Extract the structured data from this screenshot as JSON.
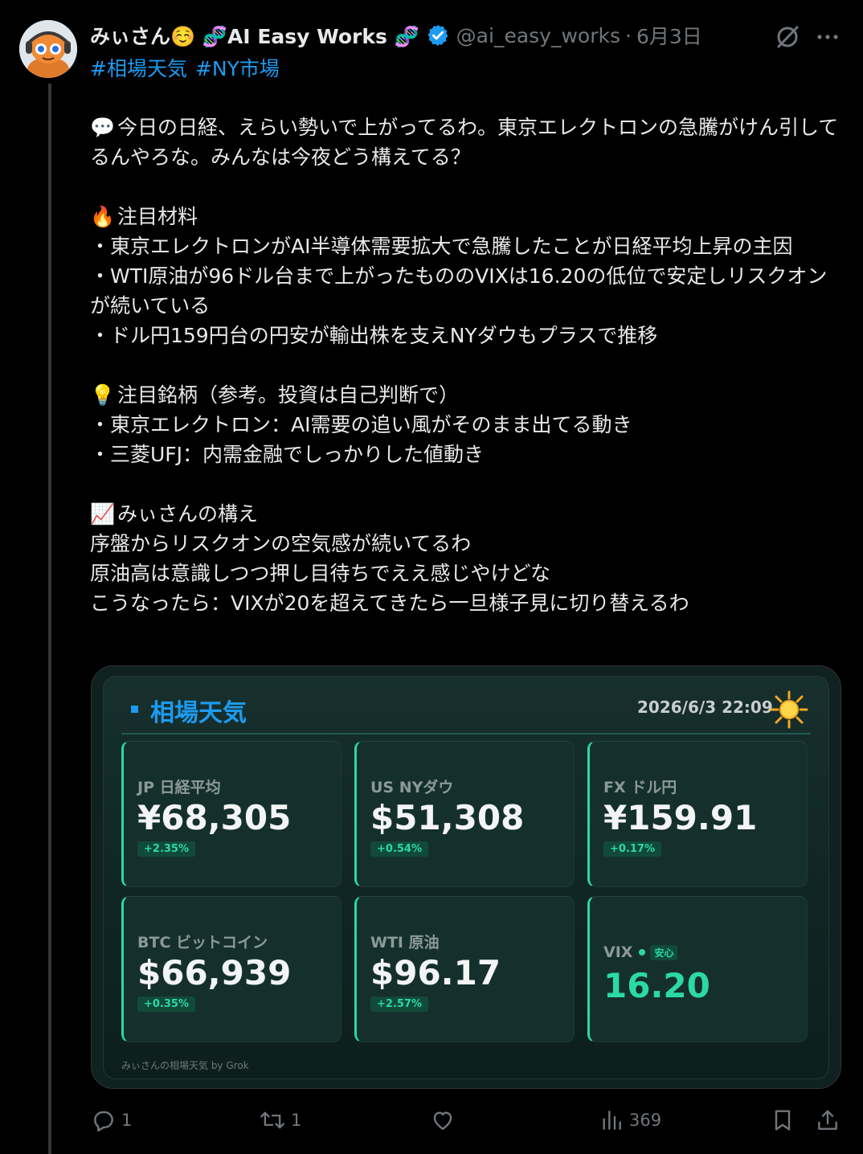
{
  "post": {
    "display_name": "みぃさん☺️ 🧬AI Easy Works 🧬",
    "handle": "@ai_easy_works",
    "separator": "·",
    "date": "6月3日",
    "hashtags": [
      "#相場天気",
      "#NY市場"
    ],
    "body": {
      "intro": "今日の日経、えらい勢いで上がってるわ。東京エレクトロンの急騰がけん引してるんやろな。みんなは今夜どう構えてる？",
      "intro_emoji": "💬",
      "section1_emoji": "🔥",
      "section1_title": "注目材料",
      "section1_items": [
        "・東京エレクトロンがAI半導体需要拡大で急騰したことが日経平均上昇の主因",
        "・WTI原油が96ドル台まで上がったもののVIXは16.20の低位で安定しリスクオンが続いている",
        "・ドル円159円台の円安が輸出株を支えNYダウもプラスで推移"
      ],
      "section2_emoji": "💡",
      "section2_title": "注目銘柄（参考。投資は自己判断で）",
      "section2_items": [
        "・東京エレクトロン：AI需要の追い風がそのまま出てる動き",
        "・三菱UFJ：内需金融でしっかりした値動き"
      ],
      "section3_emoji": "📈",
      "section3_title": "みぃさんの構え",
      "section3_lines": [
        "序盤からリスクオンの空気感が続いてるわ",
        "原油高は意識しつつ押し目待ちでええ感じやけどな",
        "こうなったら：VIXが20を超えてきたら一旦様子見に切り替えるわ"
      ]
    }
  },
  "card": {
    "title": "相場天気",
    "datetime": "2026/6/3 22:09",
    "footer": "みぃさんの相場天気 by Grok",
    "tiles": [
      {
        "label": "JP 日経平均",
        "value": "¥68,305",
        "change": "+2.35%"
      },
      {
        "label": "US NYダウ",
        "value": "$51,308",
        "change": "+0.54%"
      },
      {
        "label": "FX ドル円",
        "value": "¥159.91",
        "change": "+0.17%"
      },
      {
        "label": "BTC ビットコイン",
        "value": "$66,939",
        "change": "+0.35%"
      },
      {
        "label": "WTI 原油",
        "value": "$96.17",
        "change": "+2.57%"
      }
    ],
    "vix": {
      "label": "VIX",
      "badge": "安心",
      "value": "16.20"
    }
  },
  "actions": {
    "replies": "1",
    "reposts": "1",
    "views": "369"
  },
  "colors": {
    "background": "#000000",
    "text": "#e7e9ea",
    "muted": "#71767b",
    "link": "#1d9bf0",
    "accent_green": "#2bd9a4",
    "card_bg": "#112826"
  },
  "icons": {
    "verified": "verified-badge-icon",
    "grok": "grok-icon",
    "more": "more-icon",
    "sun": "sun-icon",
    "reply": "reply-icon",
    "repost": "repost-icon",
    "like": "like-icon",
    "views": "views-icon",
    "bookmark": "bookmark-icon",
    "share": "share-icon"
  }
}
